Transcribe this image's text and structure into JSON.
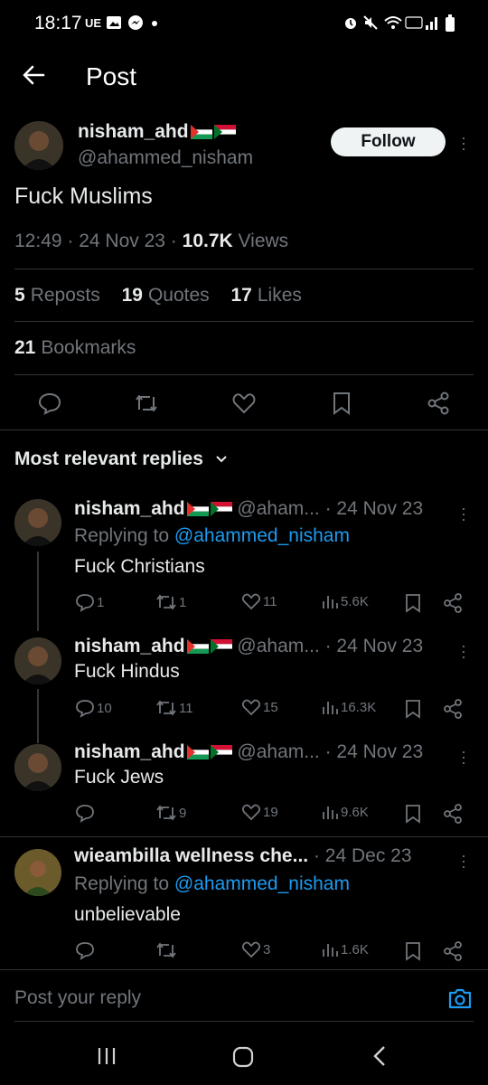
{
  "status_bar": {
    "time": "18:17",
    "carrier": "UE"
  },
  "app_bar": {
    "title": "Post"
  },
  "post": {
    "author_name": "nisham_ahd",
    "author_handle": "@ahammed_nisham",
    "follow_label": "Follow",
    "text": "Fuck Muslims",
    "time": "12:49",
    "date": "24 Nov 23",
    "views_count": "10.7K",
    "views_label": "Views",
    "reposts_count": "5",
    "reposts_label": "Reposts",
    "quotes_count": "19",
    "quotes_label": "Quotes",
    "likes_count": "17",
    "likes_label": "Likes",
    "bookmarks_count": "21",
    "bookmarks_label": "Bookmarks"
  },
  "replies_header": "Most relevant replies",
  "replies": [
    {
      "name": "nisham_ahd",
      "handle": "@aham...",
      "date": "24 Nov 23",
      "replying_prefix": "Replying to",
      "replying_to": "@ahammed_nisham",
      "text": "Fuck Christians",
      "comments": "1",
      "reposts": "1",
      "likes": "11",
      "views": "5.6K"
    },
    {
      "name": "nisham_ahd",
      "handle": "@aham...",
      "date": "24 Nov 23",
      "text": "Fuck Hindus",
      "comments": "10",
      "reposts": "11",
      "likes": "15",
      "views": "16.3K"
    },
    {
      "name": "nisham_ahd",
      "handle": "@aham...",
      "date": "24 Nov 23",
      "text": "Fuck Jews",
      "comments": "",
      "reposts": "9",
      "likes": "19",
      "views": "9.6K"
    },
    {
      "name": "wieambilla wellness che...",
      "handle": "",
      "date": "24 Dec 23",
      "replying_prefix": "Replying to",
      "replying_to": "@ahammed_nisham",
      "text": "unbelievable",
      "comments": "",
      "reposts": "",
      "likes": "3",
      "views": "1.6K"
    }
  ],
  "composer": {
    "placeholder": "Post your reply"
  },
  "colors": {
    "background": "#000000",
    "accent": "#1d9bf0",
    "muted": "#71767b",
    "text": "#e7e9ea"
  }
}
